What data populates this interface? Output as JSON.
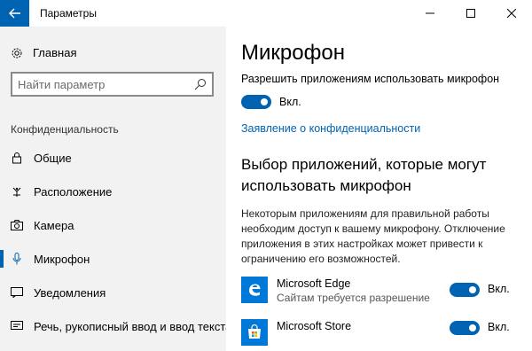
{
  "window": {
    "title": "Параметры",
    "accent_color": "#0063b1"
  },
  "sidebar": {
    "home_label": "Главная",
    "search_placeholder": "Найти параметр",
    "section_title": "Конфиденциальность",
    "items": [
      {
        "label": "Общие",
        "icon": "lock-icon",
        "active": false
      },
      {
        "label": "Расположение",
        "icon": "location-icon",
        "active": false
      },
      {
        "label": "Камера",
        "icon": "camera-icon",
        "active": false
      },
      {
        "label": "Микрофон",
        "icon": "microphone-icon",
        "active": true
      },
      {
        "label": "Уведомления",
        "icon": "notifications-icon",
        "active": false
      },
      {
        "label": "Речь, рукописный ввод и ввод текста",
        "icon": "speech-icon",
        "active": false
      }
    ]
  },
  "main": {
    "title": "Микрофон",
    "permission_label": "Разрешить приложениям использовать микрофон",
    "permission_state": "Вкл.",
    "privacy_link": "Заявление о конфиденциальности",
    "apps_heading": "Выбор приложений, которые могут использовать микрофон",
    "apps_description": "Некоторым приложениям для правильной работы необходим доступ к вашему микрофону. Отключение приложения в этих настройках может привести к ограничению его возможностей.",
    "apps": [
      {
        "name": "Microsoft Edge",
        "subtitle": "Сайтам требуется разрешение",
        "state": "Вкл.",
        "icon": "edge-icon"
      },
      {
        "name": "Microsoft Store",
        "subtitle": "",
        "state": "Вкл.",
        "icon": "store-icon"
      }
    ]
  }
}
